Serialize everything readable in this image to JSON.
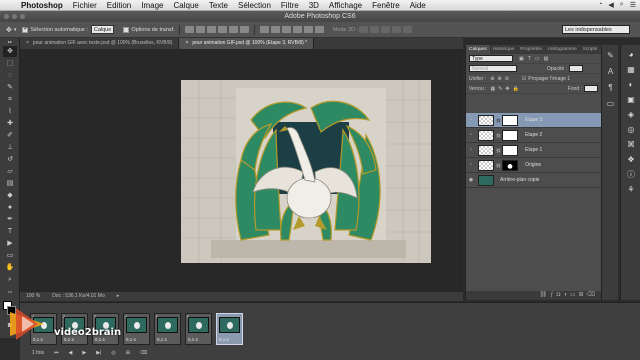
{
  "menubar": {
    "items": [
      "Photoshop",
      "Fichier",
      "Edition",
      "Image",
      "Calque",
      "Texte",
      "Sélection",
      "Filtre",
      "3D",
      "Affichage",
      "Fenêtre",
      "Aide"
    ]
  },
  "window": {
    "title": "Adobe Photoshop CS6"
  },
  "options": {
    "auto_select_label": "Sélection automatique :",
    "auto_select_value": "Calque",
    "transform_label": "Options de transf.",
    "mode3d": "Mode 3D :",
    "workspace": "Les indispensables"
  },
  "doc_tabs": [
    {
      "label": "pour animation GIF avec texte.psd @ 100% (Bruxelles, RVB/8)"
    },
    {
      "label": "pour animation GIF.psd @ 100% (Etape 3, RVB/8) *"
    }
  ],
  "status": {
    "zoom": "100 %",
    "doc": "Doc : 536,1 Ko/4,01 Mo"
  },
  "layers_panel": {
    "tabs": [
      "Calques",
      "Historique",
      "Propriétés",
      "Histogramme",
      "Scripts"
    ],
    "kind": "Type",
    "blend": "Normal",
    "opacity_label": "Opacité :",
    "unify_label": "Unifier :",
    "propagate_label": "Propager l'image 1",
    "lock_label": "Verrou :",
    "fill_label": "Fond :",
    "layers": [
      {
        "name": "Etape 3",
        "mask": "white",
        "selected": true
      },
      {
        "name": "Etape 2",
        "mask": "white",
        "selected": false
      },
      {
        "name": "Etape 1",
        "mask": "white",
        "selected": false
      },
      {
        "name": "Origine",
        "mask": "black",
        "selected": false
      },
      {
        "name": "Arrière-plan copie",
        "mask": "none",
        "selected": false
      }
    ]
  },
  "timeline": {
    "frames": [
      {
        "num": "1",
        "time": "0,1 s"
      },
      {
        "num": "2",
        "time": "0,1 s"
      },
      {
        "num": "3",
        "time": "0,1 s"
      },
      {
        "num": "4",
        "time": "0,1 s"
      },
      {
        "num": "5",
        "time": "0,1 s"
      },
      {
        "num": "6",
        "time": "0,1 s"
      },
      {
        "num": "7",
        "time": "0,1 s"
      }
    ],
    "loop": "1 fois"
  },
  "branding": {
    "logo_text": "video2brain"
  }
}
